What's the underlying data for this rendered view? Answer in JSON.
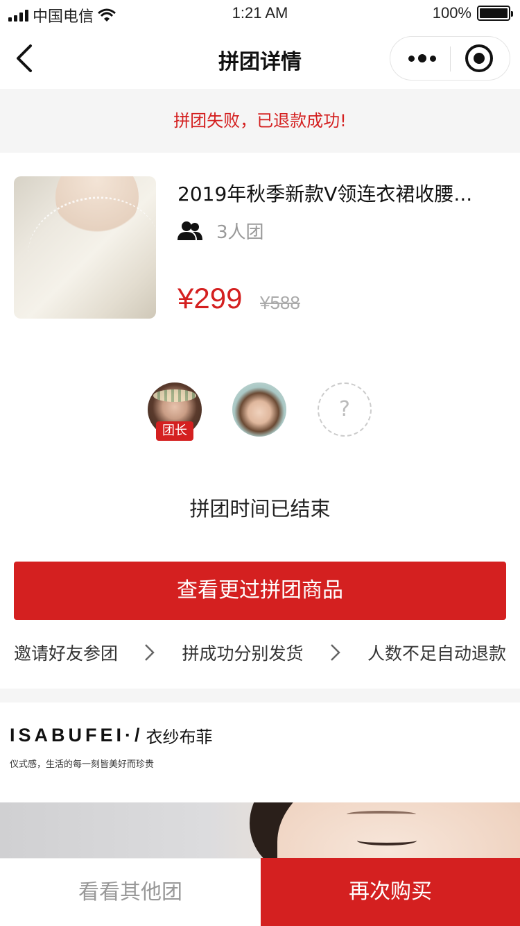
{
  "status_bar": {
    "carrier": "中国电信",
    "time": "1:21 AM",
    "battery": "100%",
    "battery_level": 1.0
  },
  "nav": {
    "title": "拼团详情",
    "back_icon": "back-arrow-icon",
    "more_icon": "more-dots-icon",
    "close_icon": "target-circle-icon"
  },
  "banner": {
    "message": "拼团失败，已退款成功!"
  },
  "product": {
    "title": "2019年秋季新款V领连衣裙收腰...",
    "group_label": "3人团",
    "price": "¥299",
    "original_price": "¥588"
  },
  "members": {
    "leader_badge": "团长",
    "empty_slot": "?"
  },
  "status_text": "拼团时间已结束",
  "primary_button": "查看更过拼团商品",
  "steps": [
    "邀请好友参团",
    "拼成功分别发货",
    "人数不足自动退款"
  ],
  "brand": {
    "logo_en": "ISABUFEI·/",
    "logo_cn": "衣纱布菲",
    "tagline": "仪式感，生活的每一刻皆美好而珍贵"
  },
  "bottom_bar": {
    "other_groups": "看看其他团",
    "buy_again": "再次购买"
  },
  "colors": {
    "accent": "#d42020",
    "muted": "#999999",
    "band": "#f5f5f5"
  }
}
